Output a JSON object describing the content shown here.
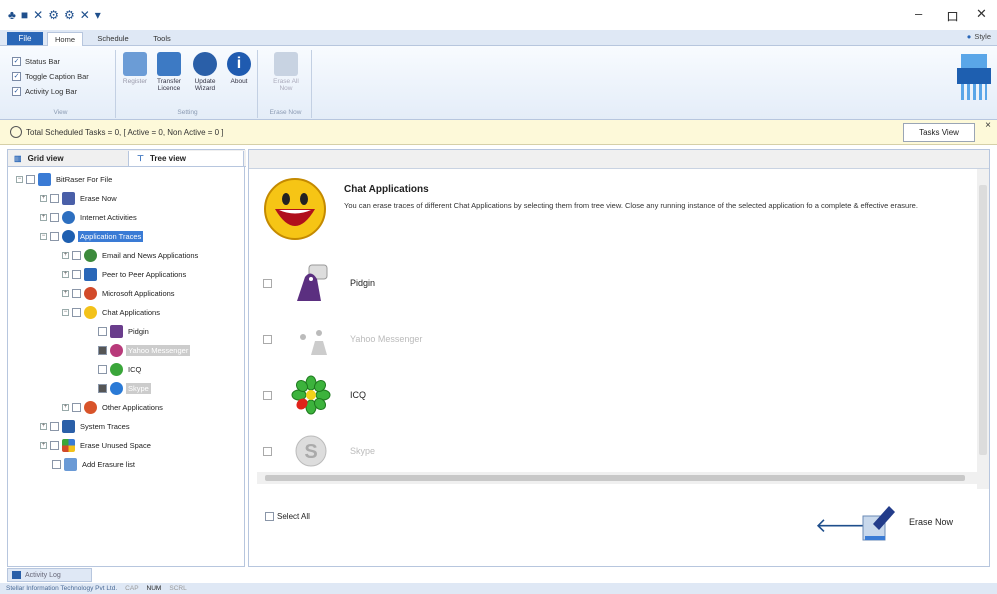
{
  "window": {
    "minimize": "–",
    "maximize": "ロ",
    "close": "✕"
  },
  "ribbon_tabs": {
    "file": "File",
    "home": "Home",
    "schedule": "Schedule",
    "tools": "Tools",
    "style": "Style"
  },
  "ribbon": {
    "view": {
      "status_bar": "Status Bar",
      "toggle_caption_bar": "Toggle Caption Bar",
      "activity_log_bar": "Activity Log Bar",
      "label": "View"
    },
    "setting": {
      "register": "Register",
      "transfer_licence": "Transfer Licence",
      "update_wizard": "Update Wizard",
      "about": "About",
      "label": "Setting"
    },
    "erase_now": {
      "erase_all_now": "Erase All Now",
      "label": "Erase Now"
    }
  },
  "infobar": {
    "text": "Total Scheduled Tasks = 0, [ Active = 0, Non Active = 0 ]",
    "tasks_view": "Tasks View",
    "close": "×"
  },
  "view_tabs": {
    "grid": "Grid view",
    "tree": "Tree view"
  },
  "tree": [
    {
      "label": "BitRaser For File"
    },
    {
      "label": "Erase Now"
    },
    {
      "label": "Internet Activities"
    },
    {
      "label": "Application Traces"
    },
    {
      "label": "Email and News Applications"
    },
    {
      "label": "Peer to Peer Applications"
    },
    {
      "label": "Microsoft Applications"
    },
    {
      "label": "Chat Applications"
    },
    {
      "label": "Pidgin"
    },
    {
      "label": "Yahoo Messenger"
    },
    {
      "label": "ICQ"
    },
    {
      "label": "Skype"
    },
    {
      "label": "Other Applications"
    },
    {
      "label": "System Traces"
    },
    {
      "label": "Erase Unused Space"
    },
    {
      "label": "Add Erasure list"
    }
  ],
  "content": {
    "title": "Chat Applications",
    "description": "You can erase traces of different Chat Applications by selecting them from tree view. Close any running instance of the selected application fo a complete & effective erasure.",
    "apps": [
      {
        "label": "Pidgin",
        "enabled": true
      },
      {
        "label": "Yahoo Messenger",
        "enabled": false
      },
      {
        "label": "ICQ",
        "enabled": true
      },
      {
        "label": "Skype",
        "enabled": false
      }
    ],
    "select_all": "Select All",
    "erase_now": "Erase Now"
  },
  "bottom": {
    "activity_log": "Activity Log",
    "status": {
      "company": "Stellar Information Technology Pvt Ltd.",
      "cap": "CAP",
      "num": "NUM",
      "scrl": "SCRL"
    }
  },
  "colors": {
    "accent": "#2a67b8",
    "selection": "#3a7bd5",
    "infobar": "#fdf9d9",
    "ribbon": "#dfe8f5"
  }
}
